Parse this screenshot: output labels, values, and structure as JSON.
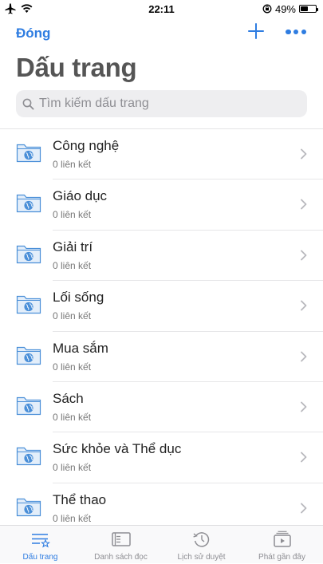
{
  "status_bar": {
    "time": "22:11",
    "battery_text": "49%",
    "battery_level": 0.49,
    "icons": [
      "airplane-icon",
      "wifi-icon",
      "orientation-lock-icon",
      "battery-icon"
    ]
  },
  "nav": {
    "close_label": "Đóng",
    "add_icon": "plus-icon",
    "more_icon": "ellipsis-icon"
  },
  "page": {
    "title": "Dấu trang"
  },
  "search": {
    "placeholder": "Tìm kiếm dấu trang",
    "value": ""
  },
  "folders": [
    {
      "name": "Công nghệ",
      "count_text": "0 liên kết"
    },
    {
      "name": "Giáo dục",
      "count_text": "0 liên kết"
    },
    {
      "name": "Giải trí",
      "count_text": "0 liên kết"
    },
    {
      "name": "Lối sống",
      "count_text": "0 liên kết"
    },
    {
      "name": "Mua sắm",
      "count_text": "0 liên kết"
    },
    {
      "name": "Sách",
      "count_text": "0 liên kết"
    },
    {
      "name": "Sức khỏe và Thể dục",
      "count_text": "0 liên kết"
    },
    {
      "name": "Thể thao",
      "count_text": "0 liên kết"
    }
  ],
  "tabs": [
    {
      "label": "Dấu trang",
      "icon": "bookmarks-icon",
      "active": true
    },
    {
      "label": "Danh sách đọc",
      "icon": "reading-list-icon",
      "active": false
    },
    {
      "label": "Lịch sử duyệt",
      "icon": "history-icon",
      "active": false
    },
    {
      "label": "Phát gần đây",
      "icon": "recently-played-icon",
      "active": false
    }
  ],
  "colors": {
    "accent": "#2f7de1",
    "folder_fill": "#e3eefa",
    "folder_stroke": "#4a8fd8",
    "title_gray": "#555555"
  }
}
